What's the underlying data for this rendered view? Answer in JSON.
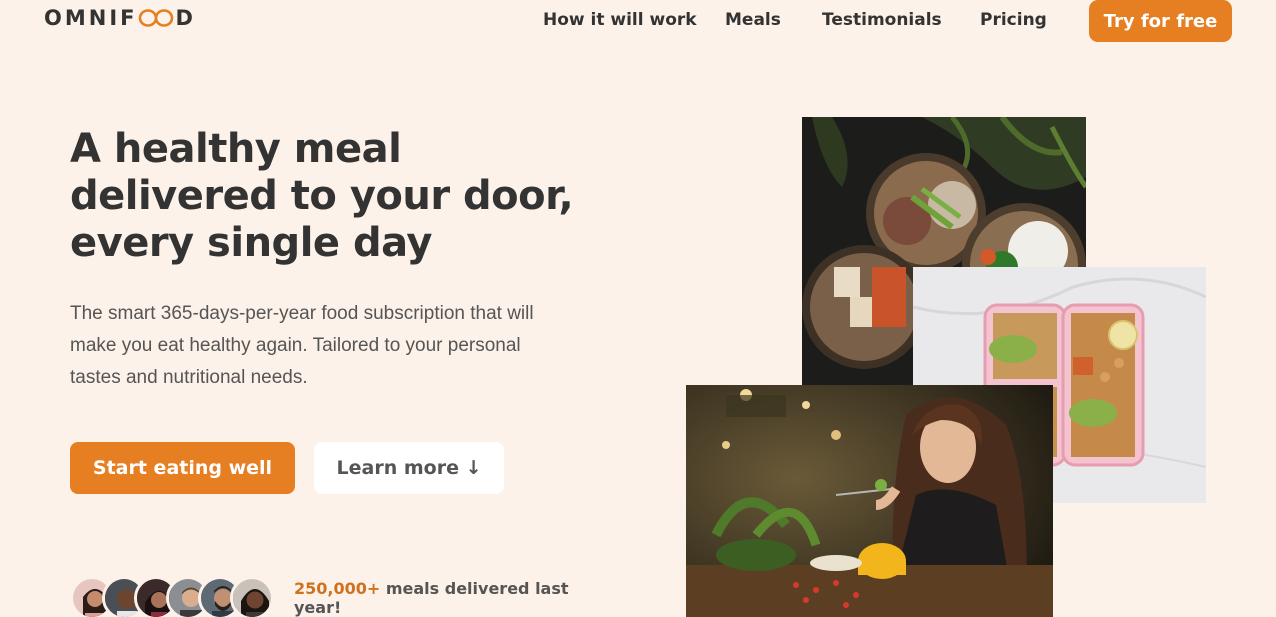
{
  "header": {
    "logo_text_left": "OMNIF",
    "logo_text_right": "D",
    "nav": {
      "how": "How it will work",
      "meals": "Meals",
      "testimonials": "Testimonials",
      "pricing": "Pricing",
      "cta": "Try for free"
    }
  },
  "hero": {
    "title": "A healthy meal delivered to your door, every single day",
    "description": "The smart 365-days-per-year food subscription that will make you eat healthy again. Tailored to your personal tastes and nutritional needs.",
    "primary_button": "Start eating well",
    "secondary_button": "Learn more ↓"
  },
  "delivered": {
    "count": "250,000+",
    "text": " meals delivered last year!"
  },
  "colors": {
    "brand": "#e67e22",
    "background": "#fdf2e9",
    "text": "#333333"
  },
  "icons": {
    "logo_mark": "infinity-loop-icon"
  }
}
